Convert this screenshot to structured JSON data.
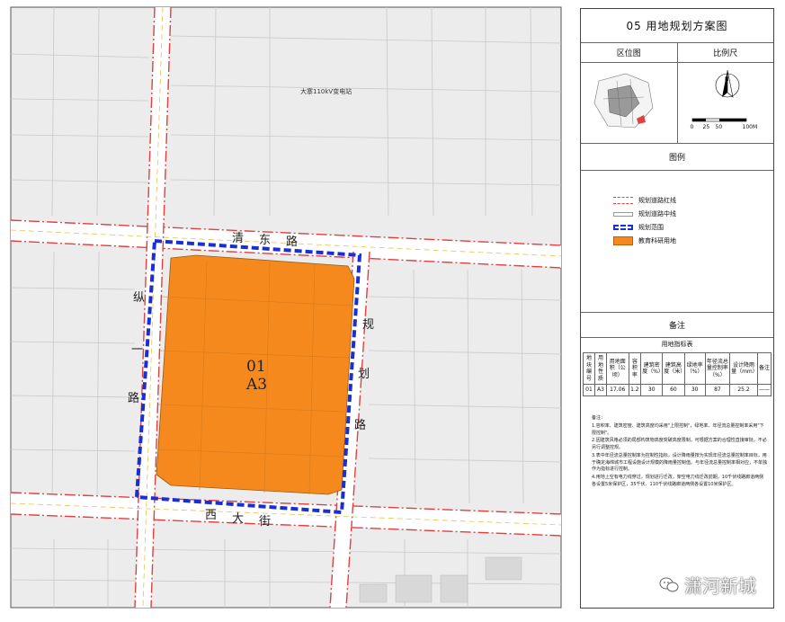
{
  "panel": {
    "title": "05 用地规划方案图",
    "location_label": "区位图",
    "scale_label": "比例尺",
    "scale_ticks": [
      "0",
      "25",
      "50",
      "100M"
    ],
    "legend_title": "图例",
    "legend": [
      {
        "label": "规划道路红线",
        "color": "#e04040"
      },
      {
        "label": "规划道路中线",
        "color": "#b0b0b0"
      },
      {
        "label": "规划范围",
        "color": "#1a2fd1"
      },
      {
        "label": "教育科研用地",
        "color": "#f5891e"
      }
    ],
    "notes_title": "备注",
    "table_title": "用地指标表",
    "table_headers": [
      "地块编号",
      "用地性质",
      "用地面积（公顷）",
      "容积率",
      "建筑密度（%）",
      "建筑高度（米）",
      "绿地率（%）",
      "年径流总量控制率（%）",
      "设计降雨量（mm）",
      "备注"
    ],
    "table_row": [
      "01",
      "A3",
      "17.06",
      "1.2",
      "30",
      "60",
      "30",
      "87",
      "25.2",
      "——"
    ],
    "notes_label": "备注：",
    "notes": [
      "1.容积率、建筑密度、建筑高度均采用\"上限控制\"，绿地率、年径流总量控制率采用\"下限控制\"。",
      "2.因建筑风格必须的局部构筑物高度突破高度限制，可根据方案的合理性直接审批，不必另行调整控规。",
      "3.表中年径流总量控制率为控制性指标，设计降雨量按为实现年径流总量控制率目标，用于确定海绵城市工程设施设计规模的降雨量控制值。与年径流总量控制率相对应，不单独作为指标进行控制。",
      "4.用地上空有电力线穿过，规划进行迁改，架空电力线迁改前期，10千伏线路廊道两侧各设置5米保护区，35千伏、110千伏线路廊道两侧各设置10米保护区。"
    ]
  },
  "map": {
    "substation_label": "大寨110kV变电站",
    "road_north": [
      "清",
      "东",
      "路"
    ],
    "road_west": [
      "纵",
      "一",
      "路"
    ],
    "road_east": [
      "规",
      "划",
      "路"
    ],
    "road_south": [
      "西",
      "大",
      "街"
    ],
    "parcel_id": "01",
    "parcel_code": "A3"
  },
  "watermark": "潇河新城",
  "colors": {
    "red_line": "#e04040",
    "road_fill": "#ffffff",
    "base_gray": "#ededed",
    "parcel_orange": "#f5891e",
    "boundary_blue": "#1a2fd1"
  }
}
